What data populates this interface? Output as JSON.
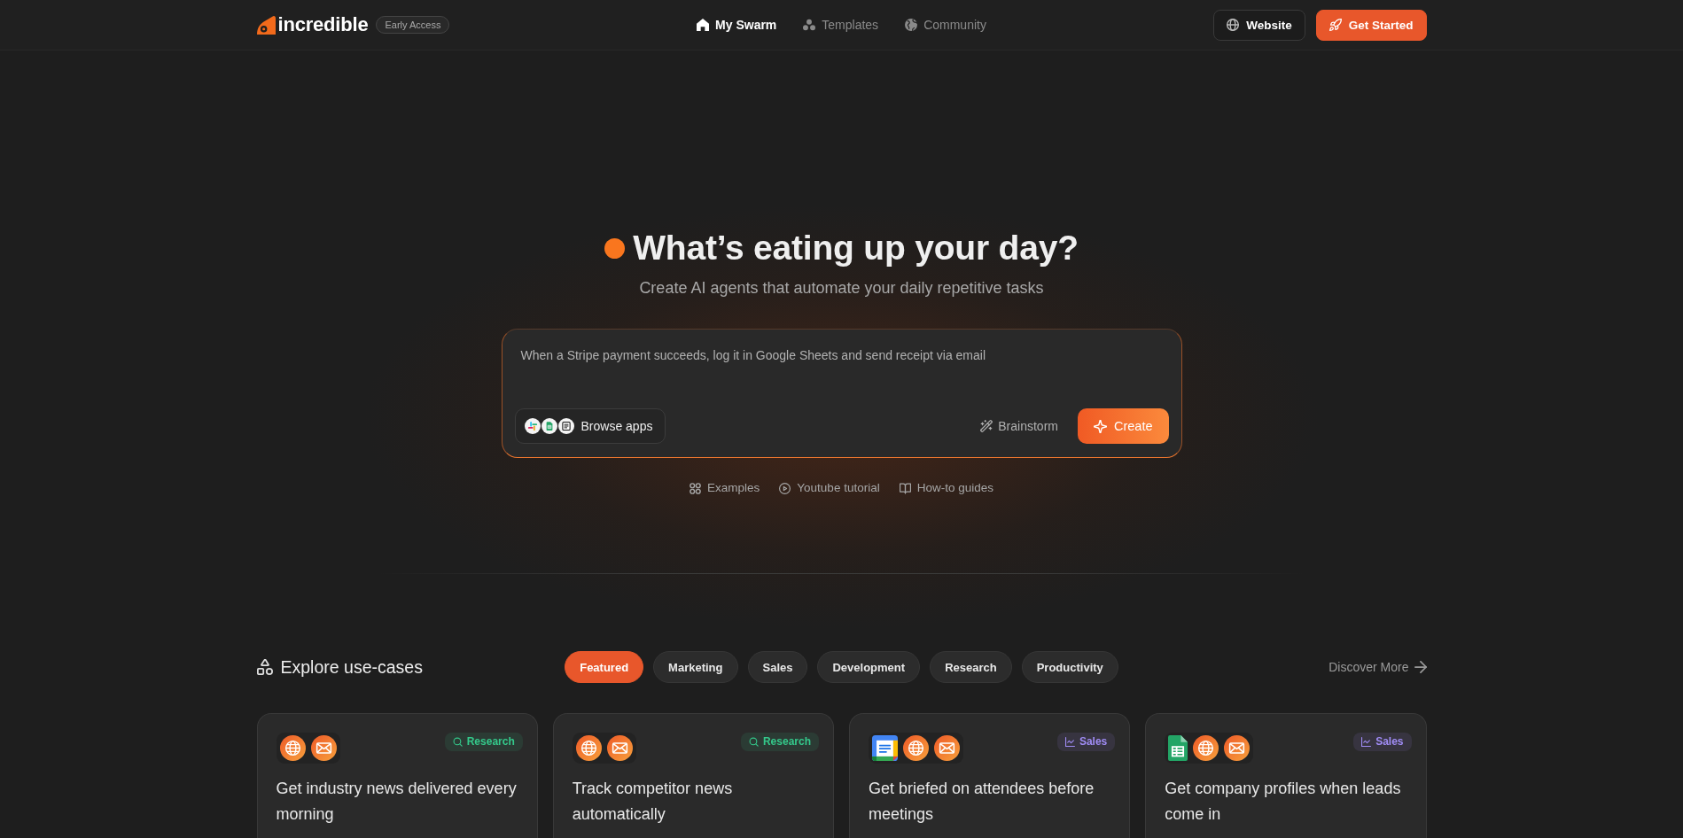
{
  "header": {
    "logo": "incredible",
    "badge": "Early Access",
    "nav": [
      {
        "label": "My Swarm",
        "selected": true
      },
      {
        "label": "Templates",
        "selected": false
      },
      {
        "label": "Community",
        "selected": false
      }
    ],
    "buttons": [
      {
        "label": "Website",
        "kind": "outline"
      },
      {
        "label": "Get Started",
        "kind": "primary"
      }
    ]
  },
  "hero": {
    "title": "What’s eating up your day?",
    "subtitle": "Create AI agents that automate your daily repetitive tasks",
    "prompt": {
      "placeholder": "When a Stripe payment succeeds, log it in Google Sheets and send receipt via email",
      "browse_apps": "Browse apps",
      "brainstorm": "Brainstorm",
      "create": "Create"
    },
    "links": [
      "Examples",
      "Youtube tutorial",
      "How-to guides"
    ]
  },
  "use_cases": {
    "title": "Explore use-cases",
    "filters": [
      {
        "label": "Featured",
        "selected": true
      },
      {
        "label": "Marketing",
        "selected": false
      },
      {
        "label": "Sales",
        "selected": false
      },
      {
        "label": "Development",
        "selected": false
      },
      {
        "label": "Research",
        "selected": false
      },
      {
        "label": "Productivity",
        "selected": false
      }
    ],
    "discover_more": "Discover More",
    "cards": [
      {
        "title": "Get industry news delivered every morning",
        "tag": "Research",
        "kind": "research",
        "color": "#34c98b",
        "apps": [
          {
            "kind": "globe"
          },
          {
            "kind": "mail"
          }
        ]
      },
      {
        "title": "Track competitor news automatically",
        "tag": "Research",
        "kind": "research",
        "color": "#34c98b",
        "apps": [
          {
            "kind": "globe"
          },
          {
            "kind": "mail"
          }
        ]
      },
      {
        "title": "Get briefed on attendees before meetings",
        "tag": "Sales",
        "kind": "sales",
        "color": "#a08cf5",
        "apps": [
          {
            "kind": "calendar"
          },
          {
            "kind": "globe"
          },
          {
            "kind": "mail"
          }
        ]
      },
      {
        "title": "Get company profiles when leads come in",
        "tag": "Sales",
        "kind": "sales",
        "color": "#a08cf5",
        "apps": [
          {
            "kind": "sheet"
          },
          {
            "kind": "globe"
          },
          {
            "kind": "mail"
          }
        ]
      }
    ]
  }
}
